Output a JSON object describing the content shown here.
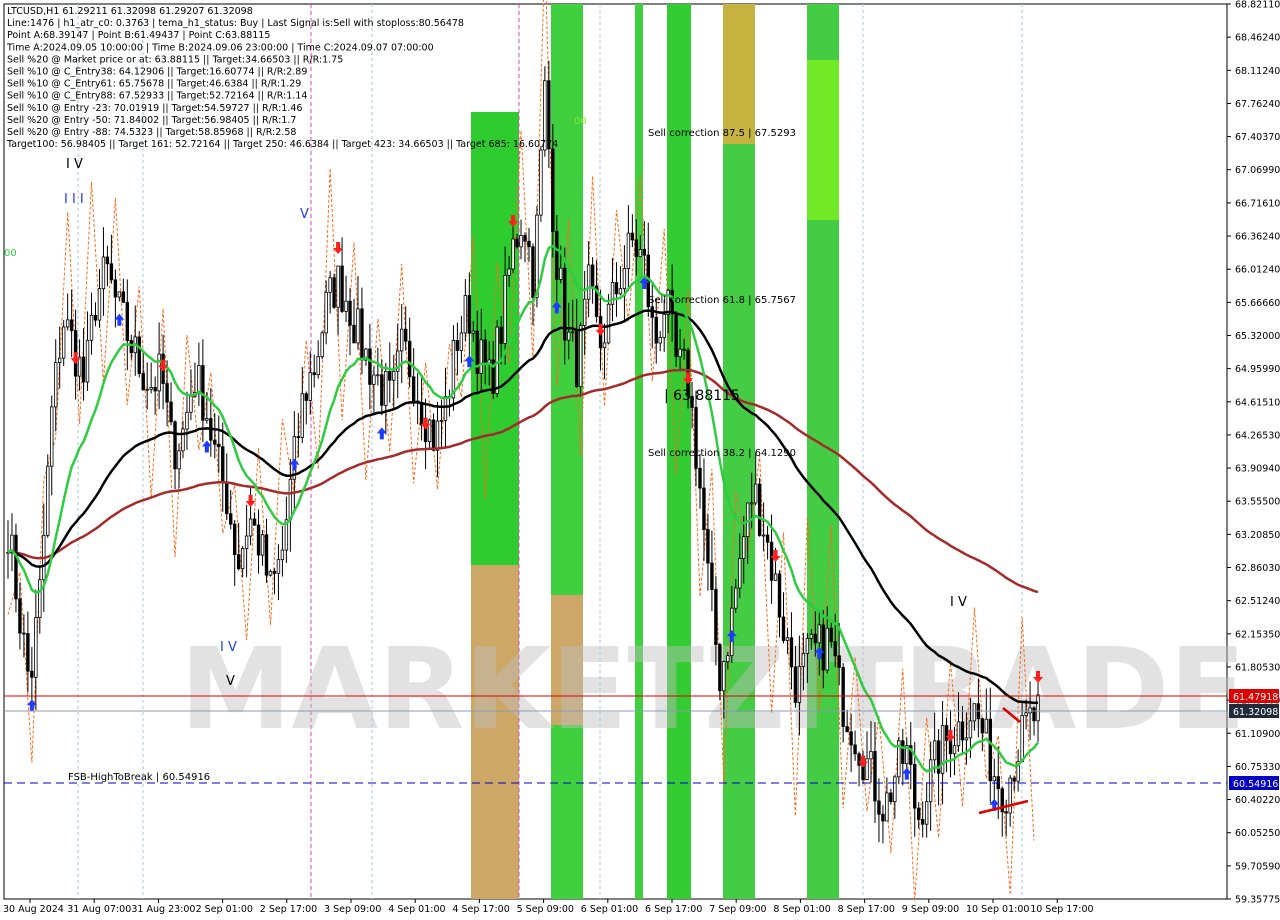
{
  "header": {
    "lines": [
      "LTCUSD,H1  61.29211 61.32098 61.29207 61.32098",
      "Line:1476  | h1_atr_c0: 0.3763  | tema_h1_status: Buy  | Last Signal is:Sell with stoploss:80.56478",
      "Point A:68.39147 | Point B:61.49437 | Point C:63.88115",
      "Time A:2024.09.05 10:00:00 | Time B:2024.09.06 23:00:00 | Time C:2024.09.07 07:00:00",
      "Sell %20 @ Market price or at: 63.88115 || Target:34.66503 || R/R:1.75",
      "Sell %10 @ C_Entry38: 64.12906 || Target:16.60774 || R/R:2.89",
      "Sell %10 @ C_Entry61: 65.75678 || Target:46.6384 || R/R:1.29",
      "Sell %10 @ C_Entry88: 67.52933 || Target:52.72164 || R/R:1.14",
      "Sell %10 @ Entry -23: 70.01919 || Target:54.59727 || R/R:1.46",
      "Sell %20 @ Entry -50: 71.84002 || Target:56.98405 || R/R:1.7",
      "Sell %20 @ Entry -88: 74.5323 || Target:58.85968 || R/R:2.58",
      "Target100: 56.98405 || Target 161: 52.72164 || Target 250: 46.6384 || Target 423: 34.66503 || Target 685: 16.60774"
    ]
  },
  "watermark": "MARKETZITRADE",
  "price_tags": {
    "red_line": "61.47918",
    "current": "61.32098",
    "blue_line": "60.54916"
  },
  "annotations": {
    "fsb": "FSB-HighToBreak | 60.54916",
    "sell_875": "Sell correction 87.5 | 67.5293",
    "sell_618": "Sell correction 61.8 | 65.7567",
    "sell_382": "Sell correction 38.2 | 64.1290",
    "point_c": "| 63.88115",
    "wave_IV_top": "I V",
    "wave_III": "I I I",
    "wave_V": "V",
    "wave_IV_mid": "I V",
    "wave_V_low": "V",
    "wave_IV_right": "I V",
    "left_edge": "00",
    "zone_tag": "00"
  },
  "colors": {
    "bull": "#000000",
    "bear": "#000000",
    "ema_green": "#2ecc40",
    "ma_black": "#000000",
    "ma_darkred": "#a52a2a",
    "red_level": "#e00000",
    "blue_level": "#0000c8",
    "arrow_up": "#1e3cff",
    "arrow_down": "#ff1e1e"
  },
  "chart_data": {
    "type": "candlestick",
    "symbol": "LTCUSD",
    "timeframe": "H1",
    "ylim": [
      59.35775,
      68.8211
    ],
    "y_ticks": [
      "68.82110",
      "68.46240",
      "68.11240",
      "67.76240",
      "67.40370",
      "67.06990",
      "66.71610",
      "66.36240",
      "66.01240",
      "65.66660",
      "65.32000",
      "64.95990",
      "64.61510",
      "64.26530",
      "63.90940",
      "63.55500",
      "63.20850",
      "62.86030",
      "62.51240",
      "62.15350",
      "61.80530",
      "61.45660",
      "61.10900",
      "60.75330",
      "60.40220",
      "60.05250",
      "59.70590",
      "59.35775"
    ],
    "x_ticks": [
      "30 Aug 2024",
      "31 Aug 07:00",
      "31 Aug 23:00",
      "2 Sep 01:00",
      "2 Sep 17:00",
      "3 Sep 09:00",
      "4 Sep 01:00",
      "4 Sep 17:00",
      "5 Sep 09:00",
      "6 Sep 01:00",
      "6 Sep 17:00",
      "7 Sep 09:00",
      "8 Sep 01:00",
      "8 Sep 17:00",
      "9 Sep 09:00",
      "10 Sep 01:00",
      "10 Sep 17:00"
    ],
    "levels": {
      "red": 61.47918,
      "current": 61.32098,
      "fsb_blue": 60.54916
    },
    "close_path": [
      63.3,
      62.4,
      61.6,
      62.7,
      64.5,
      65.5,
      65.2,
      64.8,
      65.7,
      66.0,
      65.6,
      65.3,
      65.0,
      64.8,
      64.9,
      64.1,
      64.3,
      64.9,
      64.6,
      64.0,
      63.6,
      62.9,
      63.4,
      63.1,
      62.6,
      63.0,
      63.9,
      64.7,
      65.0,
      65.6,
      65.9,
      65.7,
      65.3,
      65.0,
      64.8,
      64.6,
      65.2,
      64.9,
      64.5,
      64.2,
      64.6,
      65.3,
      65.6,
      65.1,
      64.8,
      65.4,
      66.2,
      66.6,
      65.9,
      67.9,
      66.2,
      65.3,
      65.0,
      65.8,
      65.2,
      65.6,
      66.0,
      66.3,
      66.1,
      65.2,
      65.7,
      65.0,
      64.9,
      63.9,
      62.6,
      61.7,
      62.3,
      63.1,
      63.7,
      63.3,
      62.7,
      62.1,
      61.6,
      61.9,
      62.0,
      62.1,
      61.5,
      61.2,
      60.9,
      60.6,
      60.3,
      60.7,
      60.9,
      60.2,
      60.6,
      60.9,
      61.1,
      61.2,
      61.4,
      61.1,
      60.7,
      60.5,
      60.9,
      61.2,
      61.32
    ]
  }
}
